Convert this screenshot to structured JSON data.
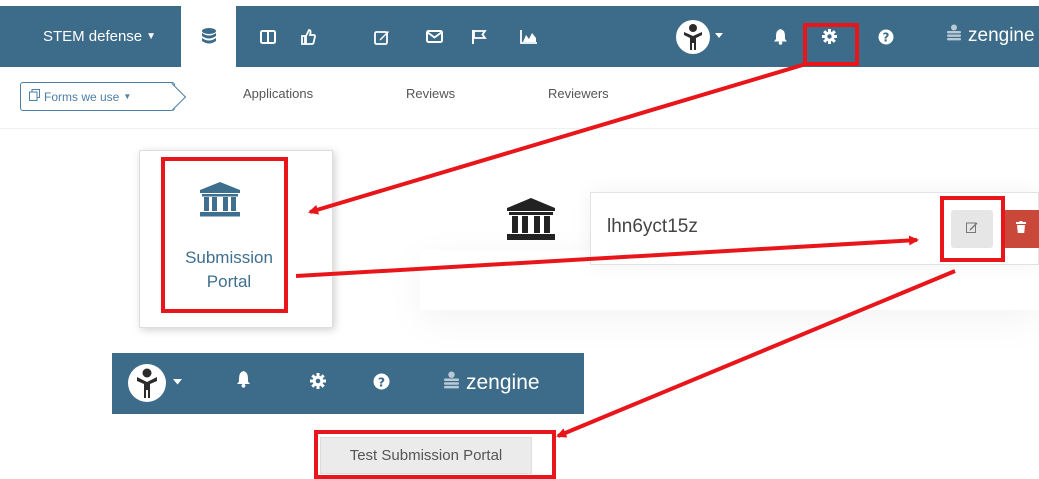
{
  "topbar": {
    "workspace_label": "STEM defense",
    "username": "zengine",
    "icons": [
      "database-icon",
      "columns-icon",
      "thumbs-up-icon",
      "edit-icon",
      "envelope-icon",
      "flag-icon",
      "chart-icon",
      "avatar-icon",
      "bell-icon",
      "gear-icon",
      "help-icon",
      "user-stack-icon"
    ]
  },
  "subnav": {
    "forms_label": "Forms we use",
    "tabs": [
      "Applications",
      "Reviews",
      "Reviewers"
    ]
  },
  "card": {
    "label_line1": "Submission",
    "label_line2": "Portal"
  },
  "portal_row": {
    "name": "lhn6yct15z"
  },
  "bottom_menu": {
    "username": "zengine",
    "menu_item": "Test Submission Portal"
  },
  "colors": {
    "navbar": "#3d6b8a",
    "accent": "#3f6f8e",
    "highlight": "#e8161a",
    "delete": "#c9483a"
  }
}
